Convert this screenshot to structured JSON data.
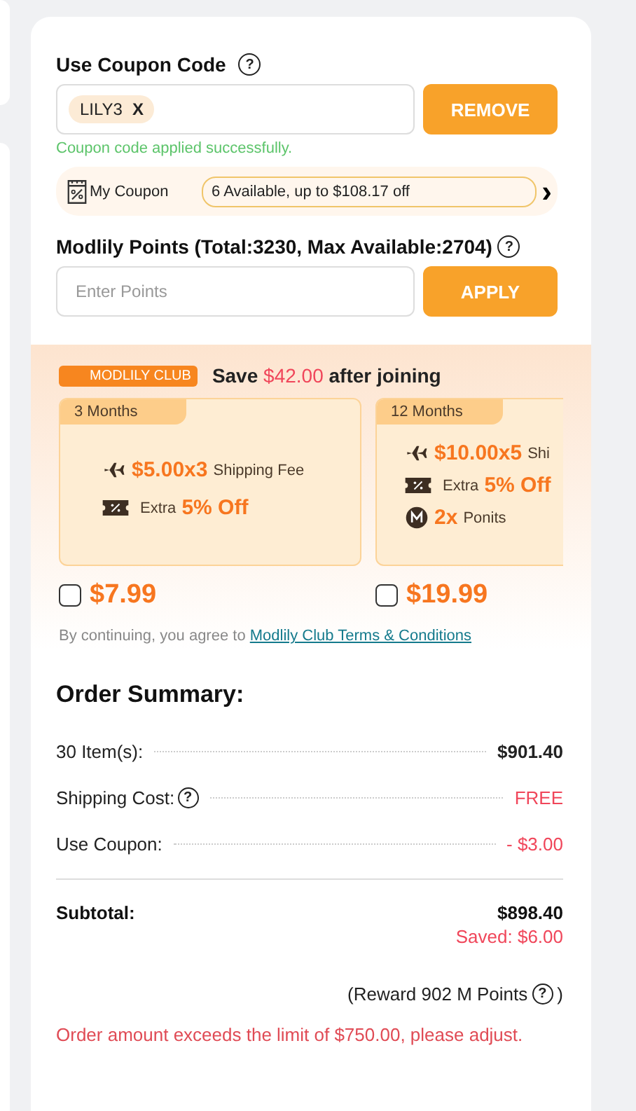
{
  "coupon": {
    "label": "Use Coupon Code",
    "help": "?",
    "code": "LILY3",
    "code_remove": "X",
    "button": "REMOVE",
    "success": "Coupon code applied successfully.",
    "my_coupon": "My Coupon",
    "available": "6 Available, up to $108.17 off",
    "arrow": "›"
  },
  "points": {
    "label": "Modlily Points (Total:3230, Max Available:2704)",
    "help": "?",
    "placeholder": "Enter Points",
    "button": "APPLY"
  },
  "club": {
    "badge": "MODLILY CLUB",
    "save_before": "Save",
    "save_amount": "$42.00",
    "save_after": "after joining",
    "plans": [
      {
        "duration": "3 Months",
        "checked": false,
        "price": "$7.99",
        "perks": [
          {
            "kind": "plane",
            "value": "$5.00x3",
            "text": "Shipping Fee"
          },
          {
            "kind": "ticket",
            "text": "Extra",
            "value": "5% Off"
          }
        ]
      },
      {
        "duration": "12 Months",
        "checked": false,
        "price": "$19.99",
        "perks": [
          {
            "kind": "plane",
            "value": "$10.00x5",
            "text": "Shi"
          },
          {
            "kind": "ticket",
            "text": "Extra",
            "value": "5% Off"
          },
          {
            "kind": "coin",
            "value": "2x",
            "text": "Ponits"
          }
        ]
      }
    ],
    "terms_before": "By continuing, you agree to",
    "terms_link": "Modlily Club Terms & Conditions"
  },
  "summary": {
    "title": "Order Summary:",
    "rows": [
      {
        "label": "30 Item(s):",
        "value": "$901.40",
        "kind": "normal"
      },
      {
        "label": "Shipping Cost:",
        "value": "FREE",
        "kind": "red",
        "help": "?"
      },
      {
        "label": "Use Coupon:",
        "value": "- $3.00",
        "kind": "red"
      }
    ],
    "subtotal_label": "Subtotal:",
    "subtotal": "$898.40",
    "saved": "Saved: $6.00",
    "reward": "(Reward 902 M Points",
    "reward_help": "?",
    "reward_close": ")",
    "warning": "Order amount exceeds the limit of $750.00, please adjust."
  }
}
